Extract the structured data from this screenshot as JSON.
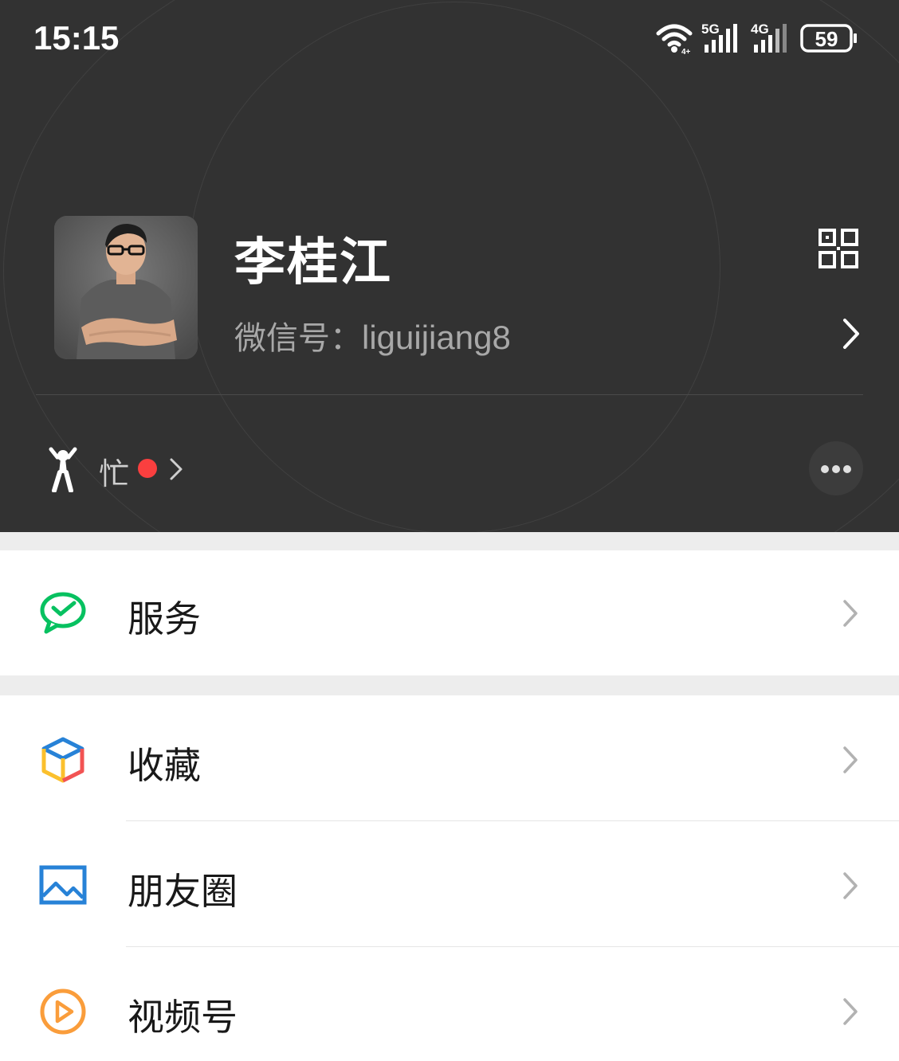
{
  "status_bar": {
    "time": "15:15",
    "network_1": "5G",
    "network_2": "4G",
    "battery": "59"
  },
  "profile": {
    "nickname": "李桂江",
    "wechat_id_label": "微信号：",
    "wechat_id": "liguijiang8",
    "status_text": "忙"
  },
  "menu": {
    "groups": [
      {
        "items": [
          {
            "label": "服务",
            "icon": "wechat-pay-icon",
            "color": "#07c160"
          }
        ]
      },
      {
        "items": [
          {
            "label": "收藏",
            "icon": "favorites-cube-icon",
            "color": "#fa9d3b"
          },
          {
            "label": "朋友圈",
            "icon": "moments-image-icon",
            "color": "#2782d7"
          },
          {
            "label": "视频号",
            "icon": "channels-play-icon",
            "color": "#fa9d3b"
          }
        ]
      }
    ]
  },
  "colors": {
    "header_bg": "#323232",
    "page_bg": "#ededed",
    "status_dot": "#fa3f3f"
  }
}
